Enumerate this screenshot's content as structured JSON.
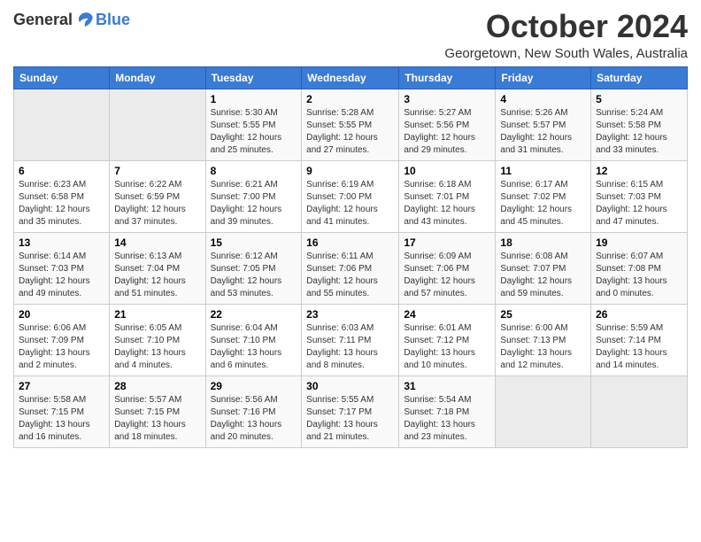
{
  "logo": {
    "general": "General",
    "blue": "Blue"
  },
  "title": {
    "month": "October 2024",
    "location": "Georgetown, New South Wales, Australia"
  },
  "days_header": [
    "Sunday",
    "Monday",
    "Tuesday",
    "Wednesday",
    "Thursday",
    "Friday",
    "Saturday"
  ],
  "weeks": [
    [
      {
        "num": "",
        "info": ""
      },
      {
        "num": "",
        "info": ""
      },
      {
        "num": "1",
        "info": "Sunrise: 5:30 AM\nSunset: 5:55 PM\nDaylight: 12 hours\nand 25 minutes."
      },
      {
        "num": "2",
        "info": "Sunrise: 5:28 AM\nSunset: 5:55 PM\nDaylight: 12 hours\nand 27 minutes."
      },
      {
        "num": "3",
        "info": "Sunrise: 5:27 AM\nSunset: 5:56 PM\nDaylight: 12 hours\nand 29 minutes."
      },
      {
        "num": "4",
        "info": "Sunrise: 5:26 AM\nSunset: 5:57 PM\nDaylight: 12 hours\nand 31 minutes."
      },
      {
        "num": "5",
        "info": "Sunrise: 5:24 AM\nSunset: 5:58 PM\nDaylight: 12 hours\nand 33 minutes."
      }
    ],
    [
      {
        "num": "6",
        "info": "Sunrise: 6:23 AM\nSunset: 6:58 PM\nDaylight: 12 hours\nand 35 minutes."
      },
      {
        "num": "7",
        "info": "Sunrise: 6:22 AM\nSunset: 6:59 PM\nDaylight: 12 hours\nand 37 minutes."
      },
      {
        "num": "8",
        "info": "Sunrise: 6:21 AM\nSunset: 7:00 PM\nDaylight: 12 hours\nand 39 minutes."
      },
      {
        "num": "9",
        "info": "Sunrise: 6:19 AM\nSunset: 7:00 PM\nDaylight: 12 hours\nand 41 minutes."
      },
      {
        "num": "10",
        "info": "Sunrise: 6:18 AM\nSunset: 7:01 PM\nDaylight: 12 hours\nand 43 minutes."
      },
      {
        "num": "11",
        "info": "Sunrise: 6:17 AM\nSunset: 7:02 PM\nDaylight: 12 hours\nand 45 minutes."
      },
      {
        "num": "12",
        "info": "Sunrise: 6:15 AM\nSunset: 7:03 PM\nDaylight: 12 hours\nand 47 minutes."
      }
    ],
    [
      {
        "num": "13",
        "info": "Sunrise: 6:14 AM\nSunset: 7:03 PM\nDaylight: 12 hours\nand 49 minutes."
      },
      {
        "num": "14",
        "info": "Sunrise: 6:13 AM\nSunset: 7:04 PM\nDaylight: 12 hours\nand 51 minutes."
      },
      {
        "num": "15",
        "info": "Sunrise: 6:12 AM\nSunset: 7:05 PM\nDaylight: 12 hours\nand 53 minutes."
      },
      {
        "num": "16",
        "info": "Sunrise: 6:11 AM\nSunset: 7:06 PM\nDaylight: 12 hours\nand 55 minutes."
      },
      {
        "num": "17",
        "info": "Sunrise: 6:09 AM\nSunset: 7:06 PM\nDaylight: 12 hours\nand 57 minutes."
      },
      {
        "num": "18",
        "info": "Sunrise: 6:08 AM\nSunset: 7:07 PM\nDaylight: 12 hours\nand 59 minutes."
      },
      {
        "num": "19",
        "info": "Sunrise: 6:07 AM\nSunset: 7:08 PM\nDaylight: 13 hours\nand 0 minutes."
      }
    ],
    [
      {
        "num": "20",
        "info": "Sunrise: 6:06 AM\nSunset: 7:09 PM\nDaylight: 13 hours\nand 2 minutes."
      },
      {
        "num": "21",
        "info": "Sunrise: 6:05 AM\nSunset: 7:10 PM\nDaylight: 13 hours\nand 4 minutes."
      },
      {
        "num": "22",
        "info": "Sunrise: 6:04 AM\nSunset: 7:10 PM\nDaylight: 13 hours\nand 6 minutes."
      },
      {
        "num": "23",
        "info": "Sunrise: 6:03 AM\nSunset: 7:11 PM\nDaylight: 13 hours\nand 8 minutes."
      },
      {
        "num": "24",
        "info": "Sunrise: 6:01 AM\nSunset: 7:12 PM\nDaylight: 13 hours\nand 10 minutes."
      },
      {
        "num": "25",
        "info": "Sunrise: 6:00 AM\nSunset: 7:13 PM\nDaylight: 13 hours\nand 12 minutes."
      },
      {
        "num": "26",
        "info": "Sunrise: 5:59 AM\nSunset: 7:14 PM\nDaylight: 13 hours\nand 14 minutes."
      }
    ],
    [
      {
        "num": "27",
        "info": "Sunrise: 5:58 AM\nSunset: 7:15 PM\nDaylight: 13 hours\nand 16 minutes."
      },
      {
        "num": "28",
        "info": "Sunrise: 5:57 AM\nSunset: 7:15 PM\nDaylight: 13 hours\nand 18 minutes."
      },
      {
        "num": "29",
        "info": "Sunrise: 5:56 AM\nSunset: 7:16 PM\nDaylight: 13 hours\nand 20 minutes."
      },
      {
        "num": "30",
        "info": "Sunrise: 5:55 AM\nSunset: 7:17 PM\nDaylight: 13 hours\nand 21 minutes."
      },
      {
        "num": "31",
        "info": "Sunrise: 5:54 AM\nSunset: 7:18 PM\nDaylight: 13 hours\nand 23 minutes."
      },
      {
        "num": "",
        "info": ""
      },
      {
        "num": "",
        "info": ""
      }
    ]
  ]
}
